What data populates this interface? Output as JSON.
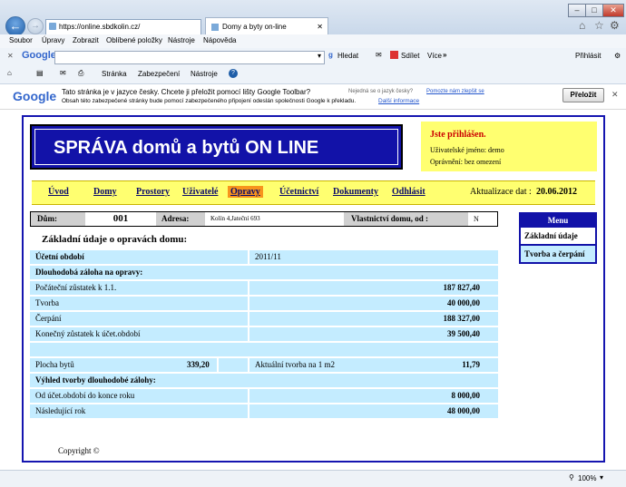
{
  "browser": {
    "address": "https://online.sbdkolin.cz/",
    "tab_title": "Domy a byty on-line",
    "menu": [
      "Soubor",
      "Úpravy",
      "Zobrazit",
      "Oblíbené položky",
      "Nástroje",
      "Nápověda"
    ],
    "google_logo": "Google",
    "search_button": "Hledat",
    "share_button": "Sdílet",
    "more_button": "Více",
    "signin": "Přihlásit",
    "cmd": [
      "Stránka",
      "Zabezpečení",
      "Nástroje"
    ],
    "translate_msg": "Tato stránka je v jazyce česky. Chcete ji přeložit pomocí lišty Google Toolbar?",
    "translate_small": "Nejedná se o jazyk česky?",
    "translate_help": "Pomozte nám zlepšit se",
    "translate_note": "Obsah této zabezpečené stránky bude pomocí zabezpečeného připojení odeslán společnosti Google k překladu.",
    "translate_info": "Další informace",
    "translate_button": "Přeložit",
    "zoom": "100%"
  },
  "site": {
    "title": "SPRÁVA domů a bytů ON LINE",
    "login_heading": "Jste přihlášen.",
    "username_label": "Uživatelské jméno: demo",
    "permission_label": "Oprávnění: bez omezení",
    "nav": [
      "Úvod",
      "Domy",
      "Prostory",
      "Uživatelé",
      "Opravy",
      "Účetnictví",
      "Dokumenty",
      "Odhlásit"
    ],
    "update_label": "Aktualizace dat :",
    "update_date": "20.06.2012"
  },
  "house": {
    "dum_label": "Dům:",
    "dum_value": "001",
    "adresa_label": "Adresa:",
    "adresa_value": "Kolín 4,Jateční 693",
    "vlastnictvi_label": "Vlastnictví domu, od :",
    "vlastnictvi_value": "N"
  },
  "sidemenu": {
    "title": "Menu",
    "items": [
      "Základní údaje",
      "Tvorba a čerpání"
    ]
  },
  "repairs": {
    "heading": "Základní údaje o opravách domu:",
    "ucetni_obdobi_label": "Účetní období",
    "ucetni_obdobi_value": "2011/11",
    "section1": "Dlouhodobá záloha na opravy:",
    "rows": [
      {
        "label": "Počáteční zůstatek k 1.1.",
        "value": "187 827,40"
      },
      {
        "label": "Tvorba",
        "value": "40 000,00"
      },
      {
        "label": "Čerpání",
        "value": "188 327,00"
      },
      {
        "label": "Konečný zůstatek k účet.období",
        "value": "39 500,40"
      }
    ],
    "plocha_label": "Plocha bytů",
    "plocha_value": "339,20",
    "tvorba_m2_label": "Aktuální tvorba na 1 m2",
    "tvorba_m2_value": "11,79",
    "section2": "Výhled tvorby dlouhodobé zálohy:",
    "outlook": [
      {
        "label": "Od účet.období do konce roku",
        "value": "8 000,00"
      },
      {
        "label": "Následující rok",
        "value": "48 000,00"
      }
    ]
  },
  "footer": {
    "copyright": "Copyright ©"
  }
}
